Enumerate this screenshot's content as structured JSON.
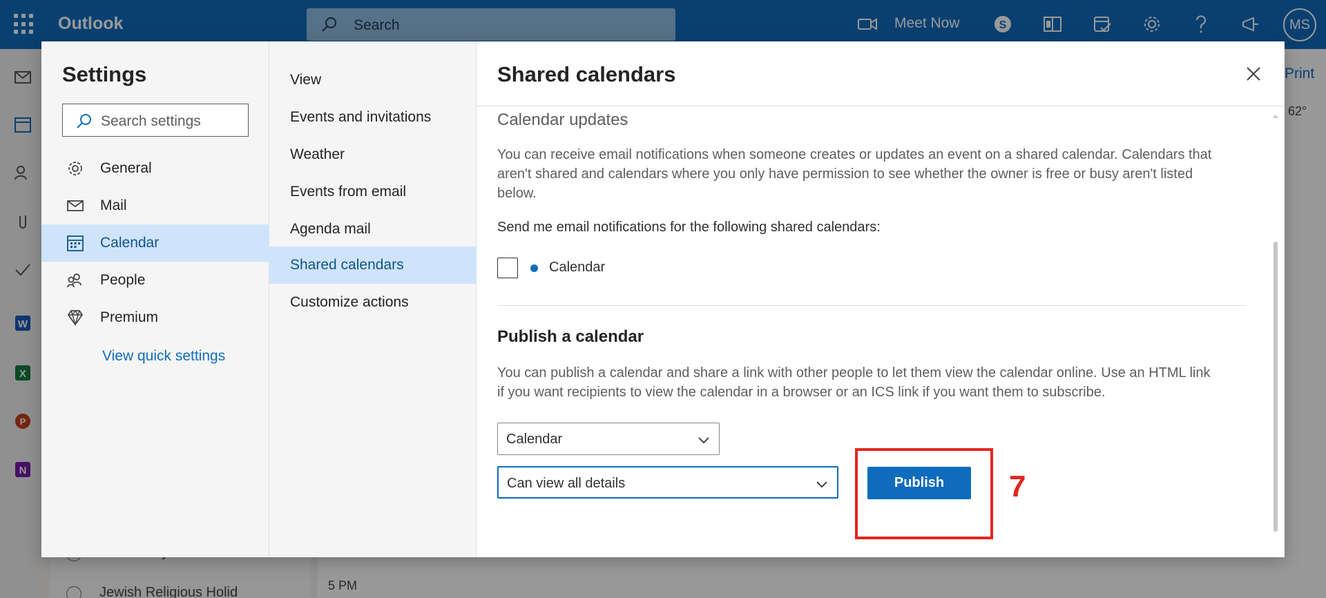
{
  "topbar": {
    "brand": "Outlook",
    "search_placeholder": "Search",
    "meet_now": "Meet Now",
    "avatar_initials": "MS"
  },
  "background": {
    "print_label": "Print",
    "temperature": "62°",
    "calendar_items": [
      "US Holidays",
      "Jewish Religious Holid"
    ],
    "time_label": "5 PM"
  },
  "settings": {
    "title": "Settings",
    "search_placeholder": "Search settings",
    "categories": [
      {
        "label": "General",
        "icon": "gear-icon"
      },
      {
        "label": "Mail",
        "icon": "mail-icon"
      },
      {
        "label": "Calendar",
        "icon": "calendar-icon",
        "selected": true
      },
      {
        "label": "People",
        "icon": "people-icon"
      },
      {
        "label": "Premium",
        "icon": "diamond-icon"
      }
    ],
    "quick_settings": "View quick settings",
    "subcategories": [
      {
        "label": "View"
      },
      {
        "label": "Events and invitations"
      },
      {
        "label": "Weather"
      },
      {
        "label": "Events from email"
      },
      {
        "label": "Agenda mail"
      },
      {
        "label": "Shared calendars",
        "selected": true
      },
      {
        "label": "Customize actions"
      }
    ]
  },
  "content": {
    "title": "Shared calendars",
    "updates_heading": "Calendar updates",
    "updates_text_1": "You can receive email notifications when someone creates or updates an event on a shared calendar. Calendars that",
    "updates_text_2": "aren't shared and calendars where you only have permission to see whether the owner is free or busy aren't listed",
    "updates_text_3": "below.",
    "send_notifications": "Send me email notifications for the following shared calendars:",
    "calendar_checkbox_label": "Calendar",
    "calendar_checked": false,
    "publish_heading": "Publish a calendar",
    "publish_text_1": "You can publish a calendar and share a link with other people to let them view the calendar online. Use an HTML link",
    "publish_text_2": "if you want recipients to view the calendar in a browser or an ICS link if you want them to subscribe.",
    "calendar_select_value": "Calendar",
    "permission_select_value": "Can view all details",
    "publish_button": "Publish",
    "annotation_number": "7",
    "accent_color": "#0f6cbd",
    "annotation_color": "#e3261f"
  }
}
